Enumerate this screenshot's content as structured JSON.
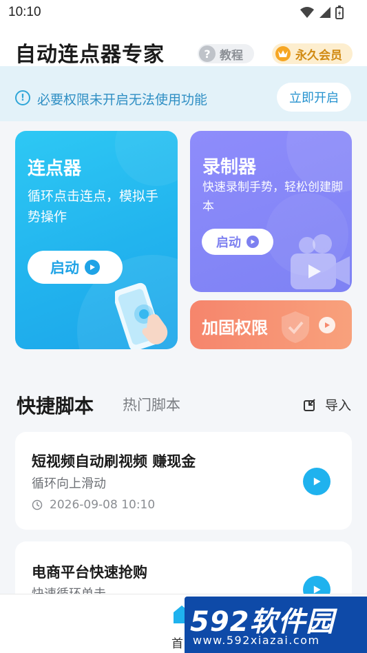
{
  "status_bar": {
    "time": "10:10"
  },
  "header": {
    "title": "自动连点器专家",
    "tutorial_label": "教程",
    "vip_label": "永久会员"
  },
  "banner": {
    "message": "必要权限未开启无法使用功能",
    "button_label": "立即开启"
  },
  "cards": {
    "clicker": {
      "title": "连点器",
      "desc": "循环点击连点，模拟手势操作",
      "button": "启动"
    },
    "recorder": {
      "title": "录制器",
      "desc": "快速录制手势，轻松创建脚本",
      "button": "启动"
    },
    "permission": {
      "title": "加固权限"
    }
  },
  "tabs": {
    "active": "快捷脚本",
    "inactive": "热门脚本",
    "import_label": "导入"
  },
  "scripts": [
    {
      "title": "短视频自动刷视频 赚现金",
      "subtitle": "循环向上滑动",
      "time": "2026-09-08 10:10"
    },
    {
      "title": "电商平台快速抢购",
      "subtitle": "快速循环单击"
    }
  ],
  "bottom_nav": {
    "home_label": "首"
  },
  "watermark": {
    "main": "592软件园",
    "sub": "www.592xiazai.com"
  },
  "colors": {
    "accent_blue": "#1fb2ee",
    "recorder_purple": "#8e8cfb",
    "permission_orange": "#f6856c",
    "vip_gold": "#d18a12"
  }
}
